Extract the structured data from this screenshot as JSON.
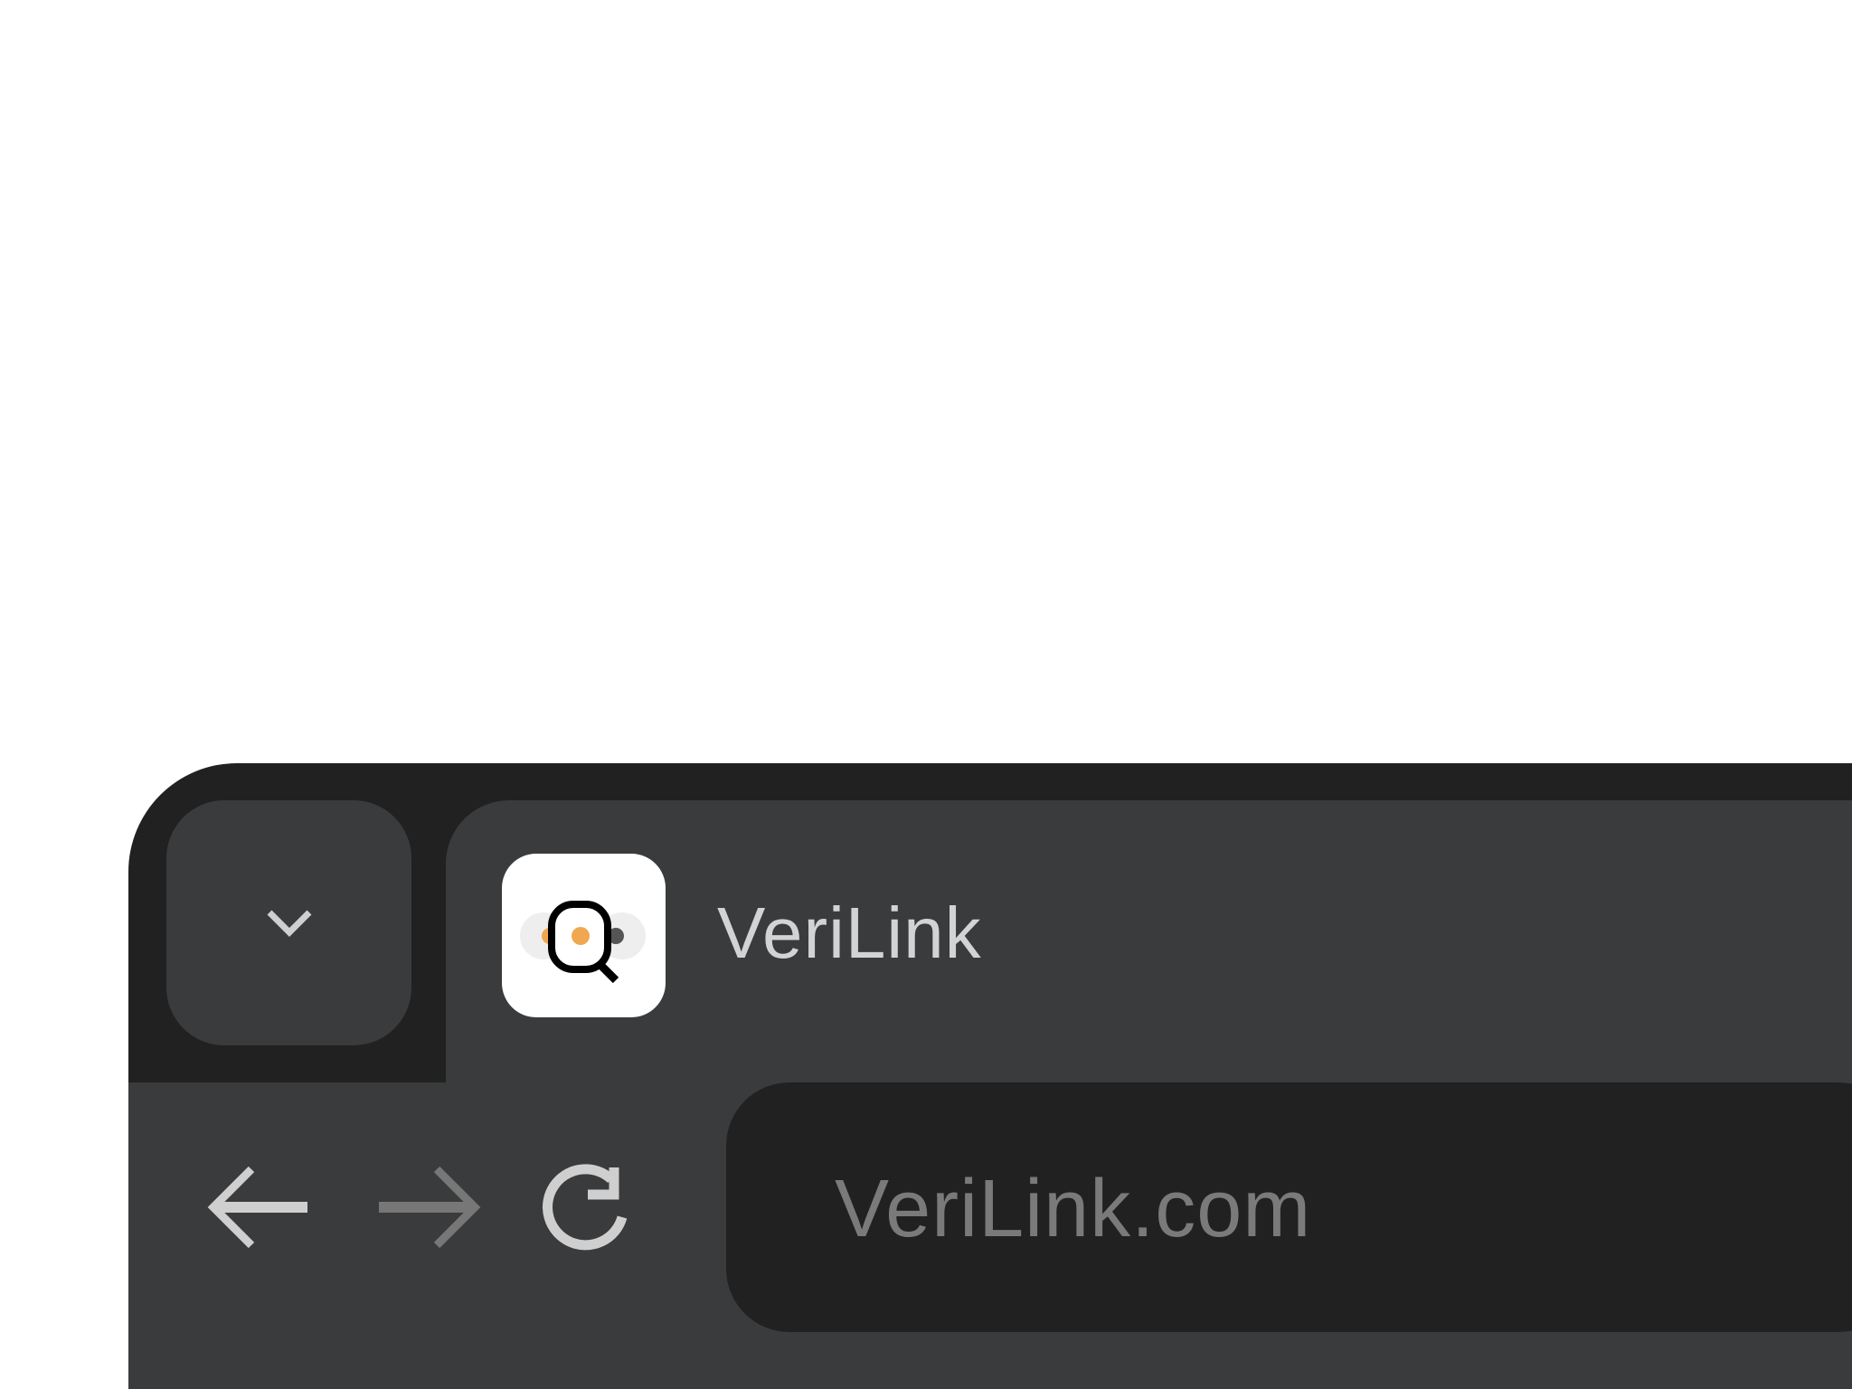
{
  "tab": {
    "title": "VeriLink",
    "favicon_icon": "magnifier-eyes-icon"
  },
  "toolbar": {
    "tab_list_icon": "chevron-down-icon",
    "back_icon": "arrow-left-icon",
    "forward_icon": "arrow-right-icon",
    "reload_icon": "reload-icon"
  },
  "address": {
    "url": "VeriLink.com"
  },
  "colors": {
    "frame": "#202120",
    "surface": "#3a3b3d",
    "text": "#d3d3d3",
    "url_text": "#7a7a7a",
    "icon_disabled": "#777777",
    "favicon_accent": "#f0a850"
  }
}
